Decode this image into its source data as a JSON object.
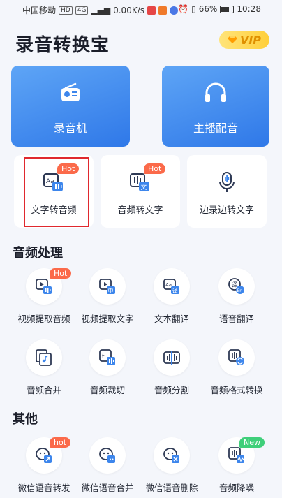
{
  "status_bar": {
    "carrier": "中国移动",
    "network": "4G",
    "speed": "0.00K/s",
    "battery": "66%",
    "time": "10:28"
  },
  "header": {
    "title": "录音转换宝",
    "vip_label": "VIP"
  },
  "big_cards": [
    {
      "label": "录音机",
      "icon": "radio-icon"
    },
    {
      "label": "主播配音",
      "icon": "headphones-icon"
    }
  ],
  "mid_cards": [
    {
      "label": "文字转音频",
      "badge": "Hot",
      "icon": "text-to-audio-icon"
    },
    {
      "label": "音频转文字",
      "badge": "Hot",
      "icon": "audio-to-text-icon"
    },
    {
      "label": "边录边转文字",
      "badge": "",
      "icon": "microphone-icon"
    }
  ],
  "sections": {
    "audio_processing": "音频处理",
    "other": "其他"
  },
  "audio_items": [
    {
      "label": "视频提取音频",
      "badge": "Hot",
      "icon": "video-audio-icon"
    },
    {
      "label": "视频提取文字",
      "badge": "",
      "icon": "video-text-icon"
    },
    {
      "label": "文本翻译",
      "badge": "",
      "icon": "text-translate-icon"
    },
    {
      "label": "语音翻译",
      "badge": "",
      "icon": "voice-translate-icon"
    },
    {
      "label": "音频合并",
      "badge": "",
      "icon": "audio-merge-icon"
    },
    {
      "label": "音频裁切",
      "badge": "",
      "icon": "audio-crop-icon"
    },
    {
      "label": "音频分割",
      "badge": "",
      "icon": "audio-split-icon"
    },
    {
      "label": "音频格式转换",
      "badge": "",
      "icon": "format-convert-icon"
    }
  ],
  "other_items": [
    {
      "label": "微信语音转发",
      "badge": "hot",
      "icon": "wechat-forward-icon"
    },
    {
      "label": "微信语音合并",
      "badge": "",
      "icon": "wechat-merge-icon"
    },
    {
      "label": "微信语音删除",
      "badge": "",
      "icon": "wechat-delete-icon"
    },
    {
      "label": "音频降噪",
      "badge": "New",
      "icon": "noise-reduce-icon"
    }
  ],
  "colors": {
    "accent_blue": "#2f78e8",
    "hot_badge": "#fb6a4a",
    "new_badge": "#3fcf7a",
    "highlight": "#e0282e"
  }
}
